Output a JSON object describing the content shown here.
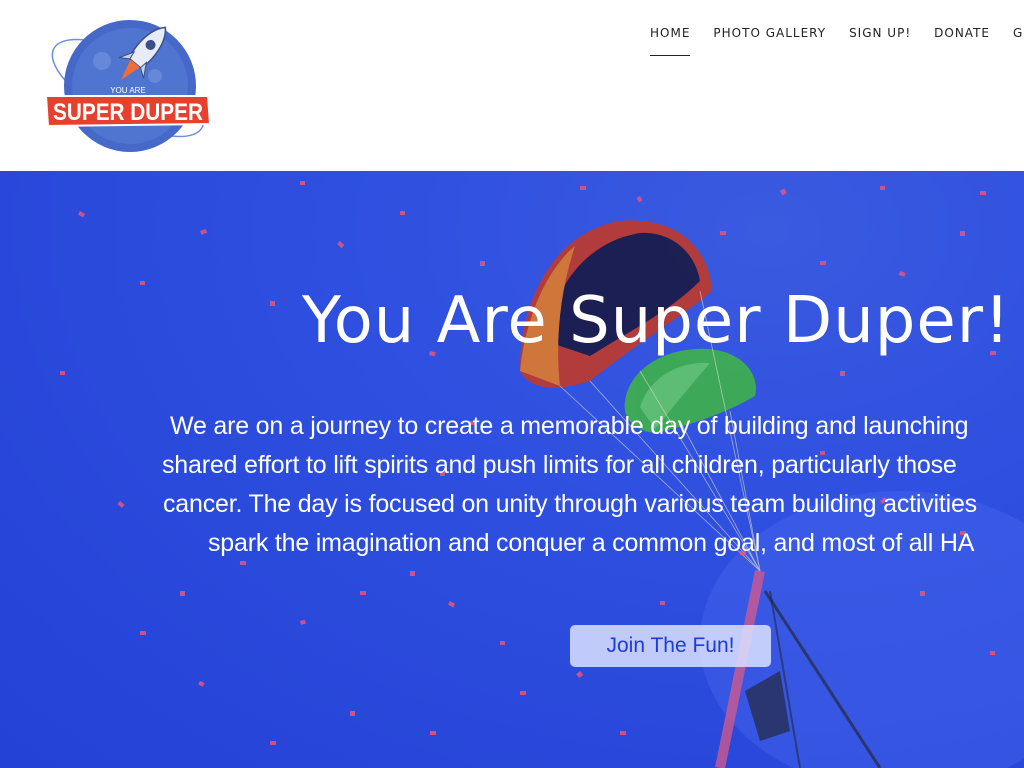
{
  "logo": {
    "small_text": "YOU ARE",
    "big_text": "SUPER DUPER"
  },
  "nav": {
    "items": [
      {
        "label": "HOME",
        "active": true
      },
      {
        "label": "PHOTO GALLERY",
        "active": false
      },
      {
        "label": "SIGN UP!",
        "active": false
      },
      {
        "label": "DONATE",
        "active": false
      },
      {
        "label": "GET",
        "active": false
      }
    ]
  },
  "hero": {
    "title": "You Are Super Duper!",
    "paragraph_lines": [
      "We are on a journey to create a memorable day of building and launching",
      "shared effort to lift spirits and push limits for all children, particularly those",
      "cancer. The day is focused on unity through various team building activities",
      "spark the imagination and conquer a common goal, and most of all HA"
    ],
    "cta_label": "Join The Fun!"
  },
  "colors": {
    "hero_blue": "#2e4fe0",
    "logo_blue": "#3d63c7",
    "banner_red": "#e8402f",
    "cta_text": "#1f3bd6"
  }
}
